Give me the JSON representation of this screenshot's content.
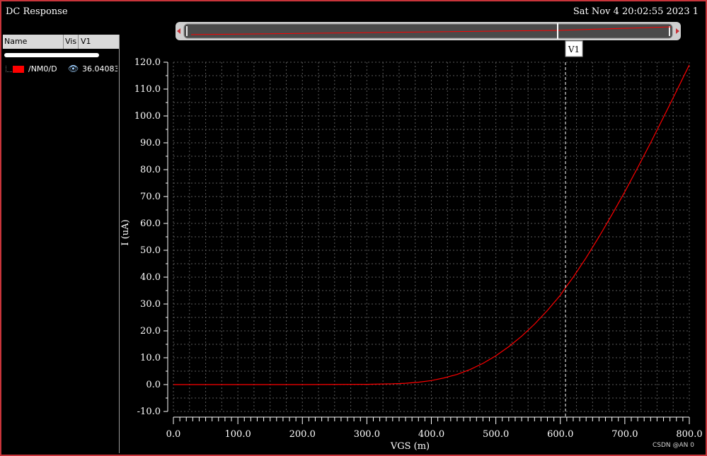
{
  "window": {
    "title": "DC Response",
    "timestamp": "Sat Nov  4 20:02:55 2023   1"
  },
  "legend": {
    "columns": [
      "Name",
      "Vis",
      "V1"
    ],
    "items": [
      {
        "name": "/NM0/D",
        "color": "#ff0000",
        "visibility_icon": "eye-icon",
        "v1_value": "36.04083("
      }
    ]
  },
  "marker": {
    "label": "V1",
    "x_value": 608
  },
  "watermark": "CSDN @AN 0",
  "chart_data": {
    "type": "line",
    "xlabel": "VGS (m)",
    "ylabel": "I (uA)",
    "xlim": [
      0,
      800
    ],
    "ylim": [
      -10,
      120
    ],
    "x_ticks": [
      "0.0",
      "100.0",
      "200.0",
      "300.0",
      "400.0",
      "500.0",
      "600.0",
      "700.0",
      "800.0"
    ],
    "y_ticks": [
      "-10.0",
      "0.0",
      "10.0",
      "20.0",
      "30.0",
      "40.0",
      "50.0",
      "60.0",
      "70.0",
      "80.0",
      "90.0",
      "100.0",
      "110.0",
      "120.0"
    ],
    "grid": true,
    "series": [
      {
        "name": "/NM0/D",
        "color": "#ff0000",
        "x": [
          0,
          100,
          200,
          300,
          340,
          360,
          380,
          400,
          420,
          440,
          460,
          480,
          500,
          520,
          540,
          560,
          580,
          600,
          608,
          620,
          640,
          660,
          680,
          700,
          720,
          740,
          760,
          780,
          800
        ],
        "y": [
          0,
          0,
          0,
          0.1,
          0.3,
          0.5,
          0.9,
          1.5,
          2.5,
          3.8,
          5.6,
          7.9,
          10.7,
          14.1,
          18.0,
          22.5,
          27.6,
          33.3,
          36.04,
          40.0,
          47.2,
          55.0,
          63.2,
          71.8,
          80.8,
          90.0,
          99.5,
          109.2,
          119.0
        ]
      }
    ]
  }
}
